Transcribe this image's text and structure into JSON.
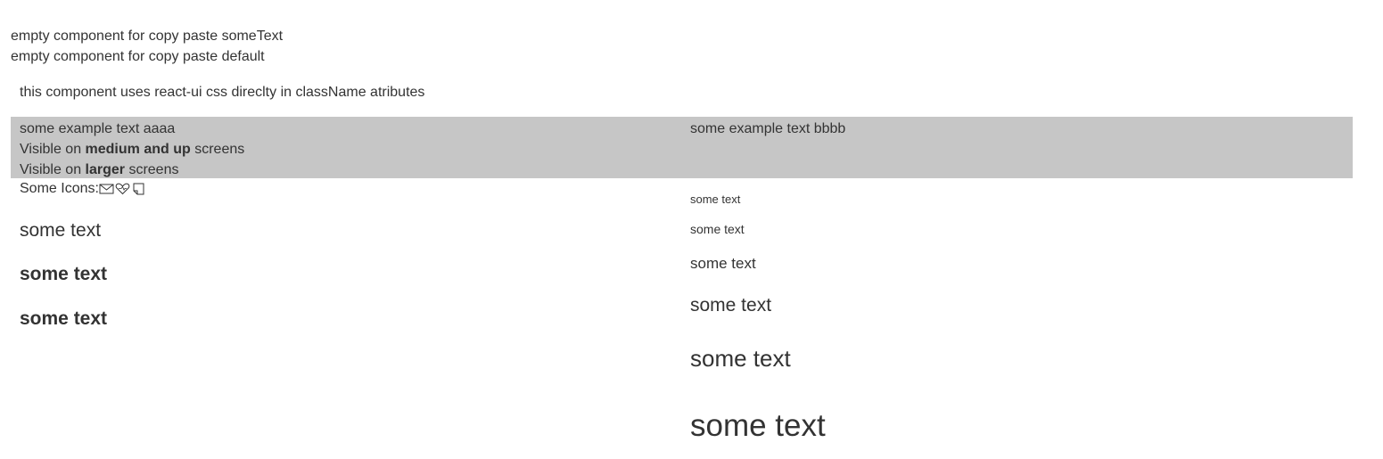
{
  "header": {
    "line1": "empty component for copy paste someText",
    "line2": "empty component for copy paste default",
    "note": "this component uses react-ui css direclty in className atributes"
  },
  "band": {
    "left_example": "some example text aaaa",
    "visible_medium_prefix": "Visible on ",
    "visible_medium_bold": "medium and up",
    "visible_medium_suffix": " screens",
    "visible_larger_prefix": "Visible on ",
    "visible_larger_bold": "larger",
    "visible_larger_suffix": " screens",
    "right_example": "some example text bbbb",
    "background_color": "#c6c6c6"
  },
  "icons_row": {
    "label": "Some Icons:",
    "icons": [
      "mail-icon",
      "heart-icon",
      "note-icon"
    ]
  },
  "left_samples": [
    "some text",
    "some text",
    "some text"
  ],
  "right_samples": [
    "some text",
    "some text",
    "some text",
    "some text",
    "some text",
    "some text"
  ]
}
